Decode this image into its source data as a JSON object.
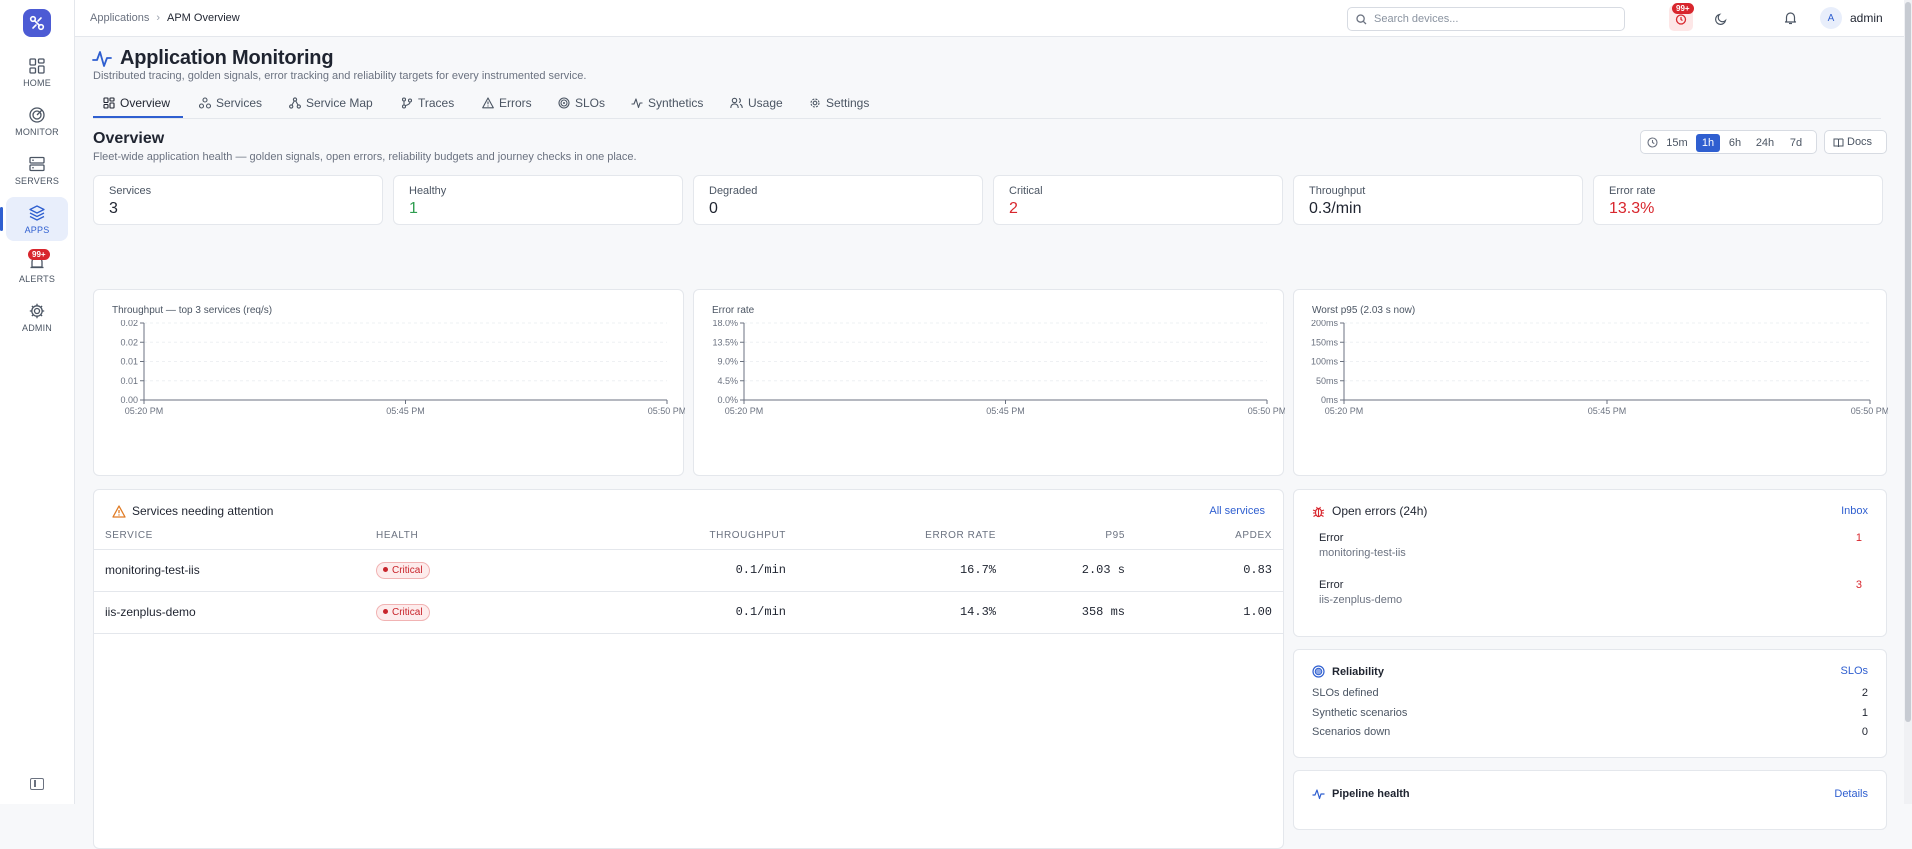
{
  "sidebar": {
    "items": [
      {
        "label": "HOME",
        "icon": "grid-icon"
      },
      {
        "label": "MONITOR",
        "icon": "radar-icon"
      },
      {
        "label": "SERVERS",
        "icon": "server-icon"
      },
      {
        "label": "APPS",
        "icon": "layers-icon"
      },
      {
        "label": "ALERTS",
        "icon": "alarm-icon",
        "badge": "99+"
      },
      {
        "label": "ADMIN",
        "icon": "gear-icon"
      }
    ]
  },
  "topbar": {
    "breadcrumb": [
      "Applications",
      "APM Overview"
    ],
    "search_placeholder": "Search devices...",
    "alert_badge": "99+",
    "avatar_initial": "A",
    "username": "admin"
  },
  "page": {
    "title": "Application Monitoring",
    "subtitle": "Distributed tracing, golden signals, error tracking and reliability targets for every instrumented service."
  },
  "tabs": [
    "Overview",
    "Services",
    "Service Map",
    "Traces",
    "Errors",
    "SLOs",
    "Synthetics",
    "Usage",
    "Settings"
  ],
  "overview": {
    "title": "Overview",
    "subtitle": "Fleet-wide application health — golden signals, open errors, reliability budgets and journey checks in one place.",
    "time_ranges": [
      "15m",
      "1h",
      "6h",
      "24h",
      "7d"
    ],
    "active_range": "1h",
    "docs_label": "Docs"
  },
  "kpis": [
    {
      "label": "Services",
      "value": "3",
      "color": "#1f2430"
    },
    {
      "label": "Healthy",
      "value": "1",
      "color": "#2e9d4f"
    },
    {
      "label": "Degraded",
      "value": "0",
      "color": "#1f2430"
    },
    {
      "label": "Critical",
      "value": "2",
      "color": "#d8262d"
    },
    {
      "label": "Throughput",
      "value": "0.3/min",
      "color": "#1f2430"
    },
    {
      "label": "Error rate",
      "value": "13.3%",
      "color": "#d8262d"
    }
  ],
  "charts": [
    {
      "title": "Throughput — top 3 services (req/s)",
      "yticks": [
        "0.02",
        "0.02",
        "0.01",
        "0.01",
        "0.00"
      ],
      "xticks": [
        "05:20 PM",
        "05:45 PM",
        "05:50 PM"
      ]
    },
    {
      "title": "Error rate",
      "yticks": [
        "18.0%",
        "13.5%",
        "9.0%",
        "4.5%",
        "0.0%"
      ],
      "xticks": [
        "05:20 PM",
        "05:45 PM",
        "05:50 PM"
      ]
    },
    {
      "title": "Worst p95 (2.03 s now)",
      "yticks": [
        "200ms",
        "150ms",
        "100ms",
        "50ms",
        "0ms"
      ],
      "xticks": [
        "05:20 PM",
        "05:45 PM",
        "05:50 PM"
      ]
    }
  ],
  "attention": {
    "title": "Services needing attention",
    "link": "All services",
    "columns": [
      "SERVICE",
      "HEALTH",
      "THROUGHPUT",
      "ERROR RATE",
      "P95",
      "APDEX"
    ],
    "rows": [
      {
        "service": "monitoring-test-iis",
        "health": "Critical",
        "throughput": "0.1/min",
        "error_rate": "16.7%",
        "p95": "2.03 s",
        "apdex": "0.83"
      },
      {
        "service": "iis-zenplus-demo",
        "health": "Critical",
        "throughput": "0.1/min",
        "error_rate": "14.3%",
        "p95": "358 ms",
        "apdex": "1.00"
      }
    ]
  },
  "open_errors": {
    "title": "Open errors (24h)",
    "link": "Inbox",
    "items": [
      {
        "type": "Error",
        "service": "monitoring-test-iis",
        "count": "1"
      },
      {
        "type": "Error",
        "service": "iis-zenplus-demo",
        "count": "3"
      }
    ]
  },
  "reliability": {
    "title": "Reliability",
    "link": "SLOs",
    "rows": [
      {
        "label": "SLOs defined",
        "value": "2"
      },
      {
        "label": "Synthetic scenarios",
        "value": "1"
      },
      {
        "label": "Scenarios down",
        "value": "0"
      }
    ]
  },
  "pipeline": {
    "title": "Pipeline health",
    "link": "Details"
  },
  "colors": {
    "accent": "#2f5fd0",
    "critical": "#d8262d",
    "healthy": "#2e9d4f"
  }
}
